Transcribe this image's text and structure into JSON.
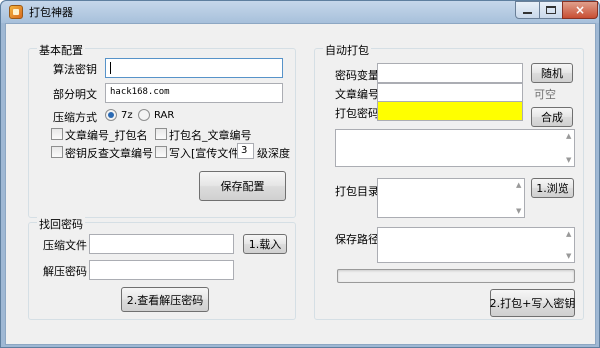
{
  "window": {
    "title": "打包神器",
    "icon": "app-package-icon",
    "controls": {
      "minimize": "minimize-icon",
      "maximize": "maximize-icon",
      "close": "×"
    }
  },
  "basic_config": {
    "legend": "基本配置",
    "algorithm_key_label": "算法密钥",
    "algorithm_key_value": "",
    "partial_plaintext_label": "部分明文",
    "partial_plaintext_value": "hack168.com",
    "compress_label": "压缩方式",
    "compress_options": [
      "7z",
      "RAR"
    ],
    "compress_selected": "7z",
    "cb_article_pack": "文章编号_打包名",
    "cb_pack_article": "打包名_文章编号",
    "cb_key_reverse": "密钥反查文章编号",
    "cb_write_promo": "写入[宣传文件]",
    "depth_value": "3",
    "depth_suffix": "级深度",
    "save_button": "保存配置"
  },
  "recover": {
    "legend": "找回密码",
    "archive_label": "压缩文件",
    "archive_value": "",
    "load_button": "1.载入",
    "unzip_pwd_label": "解压密码",
    "unzip_pwd_value": "",
    "view_button": "2.查看解压密码"
  },
  "auto_pack": {
    "legend": "自动打包",
    "pwd_var_label": "密码变量",
    "pwd_var_value": "",
    "random_button": "随机",
    "article_no_label": "文章编号",
    "article_no_value": "",
    "optional_hint": "可空",
    "pack_pwd_label": "打包密码",
    "pack_pwd_value": "",
    "compose_button": "合成",
    "pack_dir_label": "打包目录",
    "browse_button": "1.浏览",
    "save_path_label": "保存路径",
    "pack_button": "2.打包+写入密钥",
    "progress": 0,
    "highlight_color": "#ffff00"
  }
}
